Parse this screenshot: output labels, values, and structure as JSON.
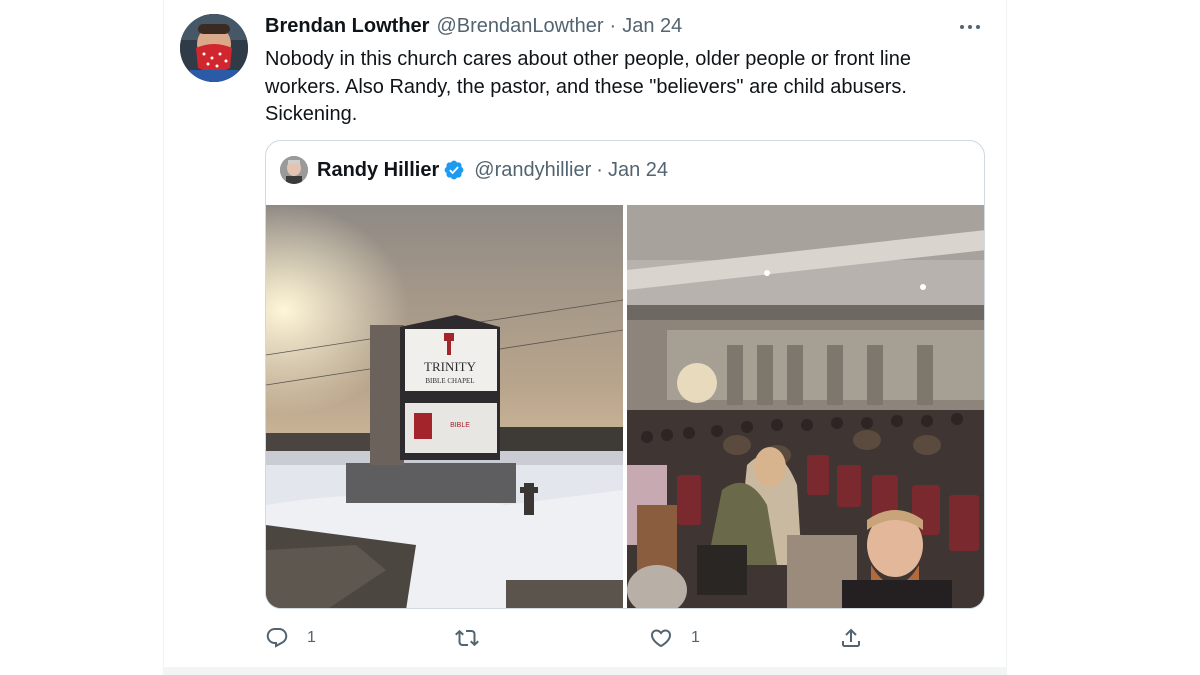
{
  "tweet": {
    "author_name": "Brendan Lowther",
    "author_handle": "@BrendanLowther",
    "separator": "·",
    "date": "Jan 24",
    "text": "Nobody in this church cares about other people, older people or front line workers. Also Randy, the pastor, and these \"believers\" are child abusers. Sickening."
  },
  "quoted_tweet": {
    "author_name": "Randy Hillier",
    "author_handle": "@randyhillier",
    "separator": "·",
    "date": "Jan 24",
    "verified": true,
    "media": [
      {
        "icon": "church-sign-photo",
        "sign_title": "TRINITY",
        "sign_subtitle": "BIBLE CHAPEL",
        "sign_lower": "BIBLE"
      },
      {
        "icon": "congregation-photo"
      }
    ]
  },
  "actions": {
    "reply_count": "1",
    "retweet_count": "",
    "like_count": "1",
    "icons": [
      "reply-icon",
      "retweet-icon",
      "like-icon",
      "share-icon"
    ]
  },
  "colors": {
    "text_primary": "#0f1419",
    "text_secondary": "#536471",
    "border": "#cfd9de",
    "verified": "#1d9bf0"
  }
}
